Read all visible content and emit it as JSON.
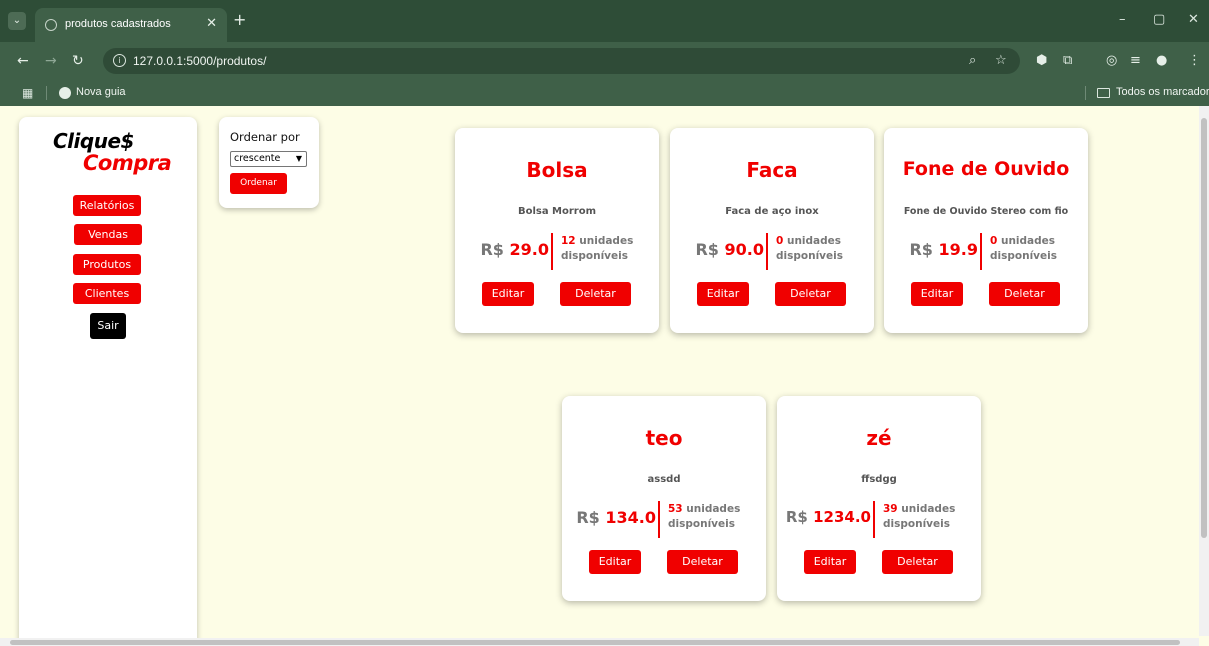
{
  "browser": {
    "tab_title": "produtos cadastrados",
    "url": "127.0.0.1:5000/produtos/",
    "bookmarks": {
      "nova_guia": "Nova guia",
      "all_bookmarks": "Todos os marcadores"
    }
  },
  "sidebar": {
    "logo": {
      "line1": "Clique$",
      "line2": "Compra"
    },
    "items": [
      {
        "label": "Relatórios"
      },
      {
        "label": "Vendas"
      },
      {
        "label": "Produtos"
      },
      {
        "label": "Clientes"
      },
      {
        "label": "Sair"
      }
    ]
  },
  "sort": {
    "label": "Ordenar por",
    "selected": "crescente",
    "button": "Ordenar"
  },
  "products": [
    {
      "name": "Bolsa",
      "description": "Bolsa Morrom",
      "currency": "R$",
      "price": "29.0",
      "quantity": "12",
      "units_label": "unidades",
      "available_label": "disponíveis",
      "edit_label": "Editar",
      "delete_label": "Deletar"
    },
    {
      "name": "Faca",
      "description": "Faca de aço inox",
      "currency": "R$",
      "price": "90.0",
      "quantity": "0",
      "units_label": "unidades",
      "available_label": "disponíveis",
      "edit_label": "Editar",
      "delete_label": "Deletar"
    },
    {
      "name": "Fone de Ouvido",
      "description": "Fone de Ouvido Stereo com fio",
      "currency": "R$",
      "price": "19.9",
      "quantity": "0",
      "units_label": "unidades",
      "available_label": "disponíveis",
      "edit_label": "Editar",
      "delete_label": "Deletar"
    },
    {
      "name": "teo",
      "description": "assdd",
      "currency": "R$",
      "price": "134.0",
      "quantity": "53",
      "units_label": "unidades",
      "available_label": "disponíveis",
      "edit_label": "Editar",
      "delete_label": "Deletar"
    },
    {
      "name": "zé",
      "description": "ffsdgg",
      "currency": "R$",
      "price": "1234.0",
      "quantity": "39",
      "units_label": "unidades",
      "available_label": "disponíveis",
      "edit_label": "Editar",
      "delete_label": "Deletar"
    }
  ],
  "colors": {
    "accent": "#f00000",
    "page_background": "#fdfde6",
    "browser_frame": "#3f6048"
  }
}
